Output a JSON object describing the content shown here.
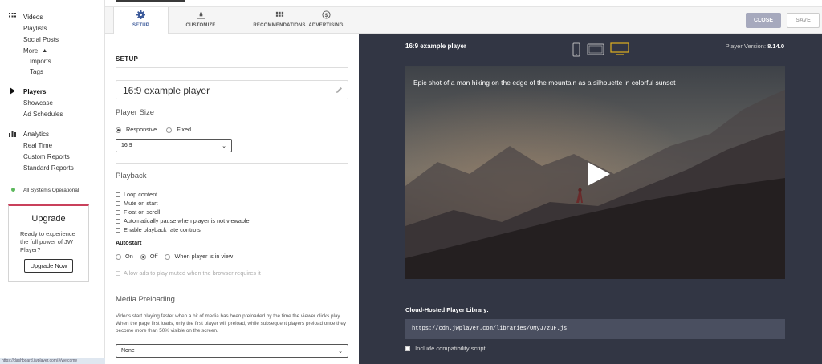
{
  "sidebar": {
    "videos": "Videos",
    "playlists": "Playlists",
    "social_posts": "Social Posts",
    "more": "More",
    "imports": "Imports",
    "tags": "Tags",
    "players": "Players",
    "showcase": "Showcase",
    "ad_schedules": "Ad Schedules",
    "analytics": "Analytics",
    "real_time": "Real Time",
    "custom_reports": "Custom Reports",
    "standard_reports": "Standard Reports",
    "status": "All Systems Operational",
    "upgrade_title": "Upgrade",
    "upgrade_text": "Ready to experience the full power of JW Player?",
    "upgrade_button": "Upgrade Now",
    "status_url": "https://dashboard.jwplayer.com/#/welcome"
  },
  "tabs": [
    {
      "label": "SETUP",
      "icon": "gear-icon",
      "active": true
    },
    {
      "label": "CUSTOMIZE",
      "icon": "brush-icon",
      "active": false
    },
    {
      "label": "RECOMMENDATIONS",
      "icon": "grid-icon",
      "active": false
    },
    {
      "label": "ADVERTISING",
      "icon": "dollar-icon",
      "active": false
    }
  ],
  "actions": {
    "close": "CLOSE",
    "save": "SAVE"
  },
  "setup": {
    "section_title": "SETUP",
    "player_name": "16:9 example player",
    "player_size_label": "Player Size",
    "size_responsive": "Responsive",
    "size_fixed": "Fixed",
    "aspect_ratio": "16:9",
    "playback_label": "Playback",
    "opt_loop": "Loop content",
    "opt_mute": "Mute on start",
    "opt_float": "Float on scroll",
    "opt_autopause": "Automatically pause when player is not viewable",
    "opt_rate": "Enable playback rate controls",
    "autostart_label": "Autostart",
    "autostart_on": "On",
    "autostart_off": "Off",
    "autostart_view": "When player is in view",
    "allow_ads_muted": "Allow ads to play muted when the browser requires it",
    "preloading_label": "Media Preloading",
    "preloading_desc": "Videos start playing faster when a bit of media has been preloaded by the time the viewer clicks play. When the page first loads, only the first player will preload, while subsequent players preload once they become more than 50% visible on the screen.",
    "preloading_value": "None"
  },
  "preview": {
    "title": "16:9 example player",
    "version_label": "Player Version:",
    "version": "8.14.0",
    "caption": "Epic shot of a man hiking on the edge of the mountain as a silhouette in colorful sunset",
    "library_title": "Cloud-Hosted Player Library:",
    "library_url": "https://cdn.jwplayer.com/libraries/OMyJ7zuF.js",
    "compat_label": "Include compatibility script"
  },
  "colors": {
    "accent": "#3c5a9a",
    "upgrade_bar": "#c9405b",
    "status_green": "#5cb85c",
    "preview_bg": "#323644",
    "desktop_icon": "#e0b020"
  }
}
